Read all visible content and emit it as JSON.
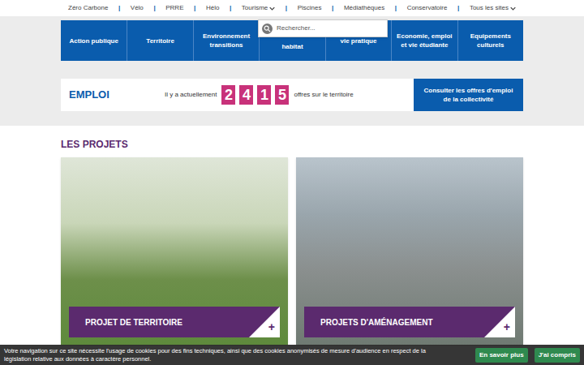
{
  "topnav": {
    "separator": "|",
    "links": [
      {
        "label": "Zéro Carbone",
        "dropdown": false
      },
      {
        "label": "Vélo",
        "dropdown": false
      },
      {
        "label": "PRRE",
        "dropdown": false
      },
      {
        "label": "Hélo",
        "dropdown": false
      },
      {
        "label": "Tourisme",
        "dropdown": true
      },
      {
        "label": "Piscines",
        "dropdown": false
      },
      {
        "label": "Médiathèques",
        "dropdown": false
      },
      {
        "label": "Conservatoire",
        "dropdown": false
      },
      {
        "label": "Tous les sites",
        "dropdown": true
      }
    ]
  },
  "search": {
    "placeholder": "Rechercher..."
  },
  "menu": [
    {
      "lines": [
        "Action publique"
      ]
    },
    {
      "lines": [
        "Territoire"
      ]
    },
    {
      "lines": [
        "Environnement",
        "transitions"
      ]
    },
    {
      "lines": [
        "habitat"
      ]
    },
    {
      "lines": [
        "vie pratique"
      ]
    },
    {
      "lines": [
        "Economie, emploi",
        "et vie étudiante"
      ]
    },
    {
      "lines": [
        "Equipements",
        "culturels"
      ]
    }
  ],
  "emploi": {
    "title": "EMPLOI",
    "before": "Il y a actuellement",
    "digits": [
      "2",
      "4",
      "1",
      "5"
    ],
    "after": "offres sur le territoire",
    "button": "Consulter les offres d'emploi de la collectivité"
  },
  "projects": {
    "heading": "LES PROJETS",
    "cards": [
      {
        "label": "PROJET DE TERRITOIRE",
        "plus": "+"
      },
      {
        "label": "PROJETS D'AMÉNAGEMENT",
        "plus": "+"
      }
    ]
  },
  "cookie": {
    "text": "Votre navigation sur ce site nécessite l'usage de cookies pour des fins techniques, ainsi que des cookies anonymisés de mesure d'audience en respect de la législation relative aux données à caractère personnel.",
    "buttons": [
      "En savoir plus",
      "J'ai compris"
    ]
  }
}
